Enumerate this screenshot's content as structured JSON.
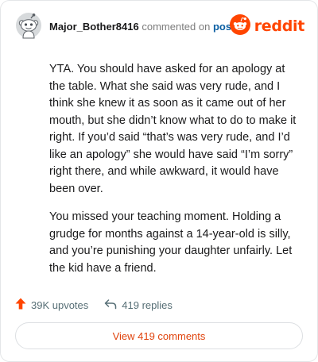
{
  "header": {
    "username": "Major_Bother8416",
    "action_text": "commented on",
    "post_link": "post",
    "logo_text": "reddit",
    "avatar_icon": "snoo-avatar-icon",
    "logo_icon": "reddit-alien-icon"
  },
  "comment": {
    "paragraphs": [
      "YTA. You should have asked for an apology at the table. What she said was very rude, and I think she knew it as soon as it came out of her mouth, but she didn’t know what to do to make it right. If you’d said “that’s was very rude, and I’d like an apology” she would have said “I’m sorry” right there, and while awkward, it would have been over.",
      "You missed your teaching moment. Holding a grudge for months against a 14-year-old is silly, and you’re punishing your daughter unfairly. Let the kid have a friend."
    ]
  },
  "actions": {
    "upvotes": "39K upvotes",
    "replies": "419 replies",
    "upvote_icon": "upvote-arrow-icon",
    "reply_icon": "reply-arrow-icon"
  },
  "footer": {
    "view_comments": "View 419 comments"
  },
  "colors": {
    "brand": "#ff4500",
    "link": "#0b5fa3",
    "muted": "#576f76",
    "button_text": "#e0440e"
  }
}
